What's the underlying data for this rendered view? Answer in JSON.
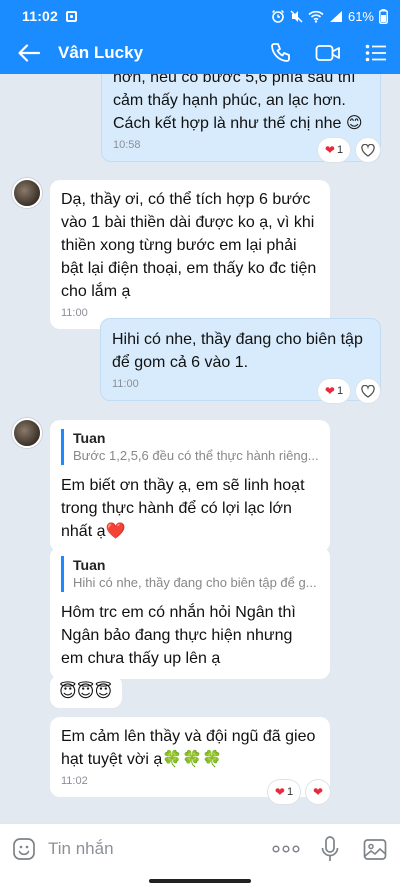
{
  "status": {
    "time": "11:02",
    "battery": "61%"
  },
  "header": {
    "title": "Vân Lucky"
  },
  "messages": {
    "m1": {
      "lines": [
        "hơn, nếu có bước 5,6 phía sau thì",
        "cảm thấy hạnh phúc, an lạc hơn.",
        "Cách kết hợp là như thế chị nhe 😊"
      ],
      "time": "10:58",
      "reaction_count": "1"
    },
    "m2": {
      "text": "Dạ, thầy ơi, có thể tích hợp 6 bước vào 1 bài thiền dài được ko ạ, vì khi thiền xong từng bước em lại phải bật lại điện thoại, em thấy ko đc tiện cho lắm ạ",
      "time": "11:00"
    },
    "m3": {
      "text": "Hihi có nhe, thầy đang cho biên tập để gom cả 6 vào 1.",
      "time": "11:00",
      "reaction_count": "1"
    },
    "m4": {
      "quote_name": "Tuan",
      "quote_text": "Bước 1,2,5,6 đều có thể thực hành riêng...",
      "text": "Em biết ơn thầy ạ, em sẽ linh hoạt trong thực hành để có lợi lạc lớn nhất ạ❤️"
    },
    "m5": {
      "quote_name": "Tuan",
      "quote_text": "Hihi có nhe, thầy đang cho biên tập để g...",
      "text": "Hôm trc em có nhắn hỏi Ngân thì Ngân bảo đang thực hiện nhưng em chưa thấy up lên ạ"
    },
    "m6": {
      "text": "😇😇😇"
    },
    "m7": {
      "text": "Em cảm lên thầy và đội ngũ đã gieo hạt tuyệt vời ạ🍀🍀🍀",
      "time": "11:02",
      "reaction_count": "1"
    }
  },
  "input": {
    "placeholder": "Tin nhắn"
  },
  "colors": {
    "header": "#1a8cff",
    "outgoing": "#d7ebfc",
    "incoming": "#ffffff",
    "background": "#e2e9f1",
    "heart": "#e8293b"
  },
  "icons": [
    "back-arrow-icon",
    "phone-icon",
    "video-icon",
    "menu-icon",
    "sticker-icon",
    "more-icon",
    "microphone-icon",
    "image-icon",
    "heart-icon",
    "like-icon"
  ]
}
